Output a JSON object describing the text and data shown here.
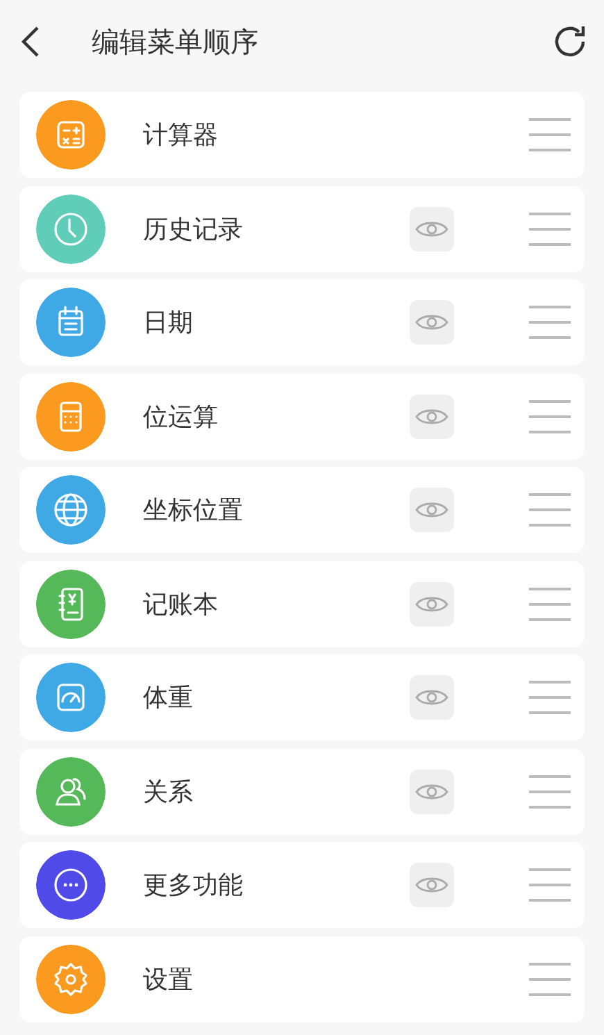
{
  "header": {
    "title": "编辑菜单顺序"
  },
  "items": [
    {
      "label": "计算器",
      "kind": "calculator",
      "color": "#fb9a1e",
      "visibility_toggle": false
    },
    {
      "label": "历史记录",
      "kind": "clock",
      "color": "#5fcdb8",
      "visibility_toggle": true
    },
    {
      "label": "日期",
      "kind": "calendar",
      "color": "#3fa9e6",
      "visibility_toggle": true
    },
    {
      "label": "位运算",
      "kind": "keypad",
      "color": "#fb9a1e",
      "visibility_toggle": true
    },
    {
      "label": "坐标位置",
      "kind": "globe",
      "color": "#3fa9e6",
      "visibility_toggle": true
    },
    {
      "label": "记账本",
      "kind": "ledger",
      "color": "#55b95a",
      "visibility_toggle": true
    },
    {
      "label": "体重",
      "kind": "gauge",
      "color": "#3fa9e6",
      "visibility_toggle": true
    },
    {
      "label": "关系",
      "kind": "people",
      "color": "#55b95a",
      "visibility_toggle": true
    },
    {
      "label": "更多功能",
      "kind": "more",
      "color": "#4f4ae8",
      "visibility_toggle": true
    },
    {
      "label": "设置",
      "kind": "gear",
      "color": "#fb9a1e",
      "visibility_toggle": false
    }
  ]
}
